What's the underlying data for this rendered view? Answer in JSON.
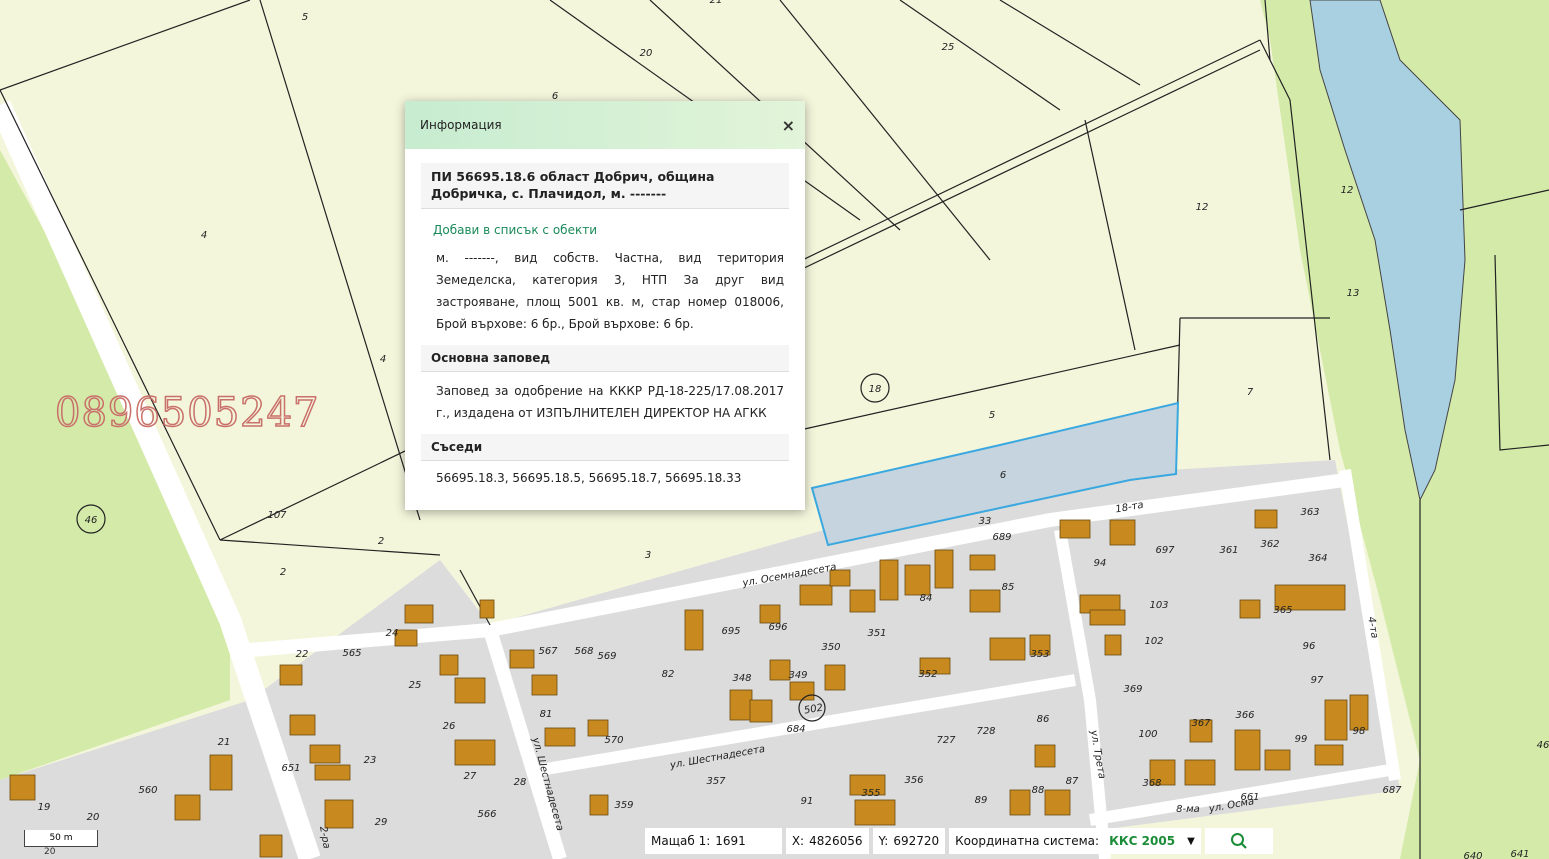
{
  "map": {
    "parcel_labels": [
      "5",
      "21",
      "20",
      "25",
      "6",
      "4",
      "12",
      "13",
      "4",
      "7",
      "5",
      "6",
      "33",
      "689",
      "18-та",
      "107",
      "2",
      "2",
      "3",
      "46",
      "18",
      "697",
      "361",
      "362",
      "363",
      "364",
      "94",
      "103",
      "102",
      "365",
      "96",
      "97",
      "85",
      "84",
      "351",
      "350",
      "695",
      "696",
      "567",
      "568",
      "569",
      "82",
      "348",
      "349",
      "352",
      "353",
      "22",
      "565",
      "24",
      "25",
      "26",
      "21",
      "23",
      "651",
      "19",
      "560",
      "20",
      "29",
      "27",
      "28",
      "566",
      "570",
      "81",
      "359",
      "357",
      "356",
      "355",
      "91",
      "89",
      "88",
      "87",
      "727",
      "728",
      "86",
      "369",
      "100",
      "367",
      "366",
      "99",
      "98",
      "368",
      "661",
      "687",
      "641",
      "640",
      "502",
      "684",
      "8-ма",
      "ул. Осемнадесета",
      "ул. Шестнадесета",
      "ул. Шестнадесета",
      "ул. Трета",
      "ул. Осма",
      "4-та",
      "46",
      "12",
      "2-ра"
    ],
    "watermark": "0896505247"
  },
  "popup": {
    "title": "Информация",
    "close": "×",
    "parcel_heading": "ПИ 56695.18.6 област Добрич, община Добричка, с. Плачидол, м. -------",
    "add_link": "Добави в списък с обекти",
    "details": "м. -------, вид собств. Частна, вид територия Земеделска, категория 3, НТП За друг вид застрояване, площ 5001 кв. м, стар номер 018006, Брой върхове: 6 бр., Брой върхове: 6 бр.",
    "order_heading": "Основна заповед",
    "order_text": "Заповед за одобрение на КККР РД-18-225/17.08.2017 г., издадена от ИЗПЪЛНИТЕЛЕН ДИРЕКТОР НА АГКК",
    "neighbors_heading": "Съседи",
    "neighbors_text": "56695.18.3, 56695.18.5, 56695.18.7, 56695.18.33"
  },
  "scale_bar": {
    "label": "50 m",
    "under": "20"
  },
  "status": {
    "scale_label": "Мащаб 1:",
    "scale_value": "1691",
    "x_label": "X:",
    "x_value": "4826056",
    "y_label": "Y:",
    "y_value": "692720",
    "crs_label": "Координатна система:",
    "crs_value": "ККС 2005",
    "crs_arrow": "▼"
  },
  "colors": {
    "field": "#f4f6dc",
    "green_area": "#d4eaa9",
    "water": "#a8d0e0",
    "urban": "#dcdcdc",
    "building": "#c88a1e",
    "selected_parcel": "#c5d4de",
    "selected_outline": "#3aa8e0",
    "accent": "#1b8c38"
  }
}
